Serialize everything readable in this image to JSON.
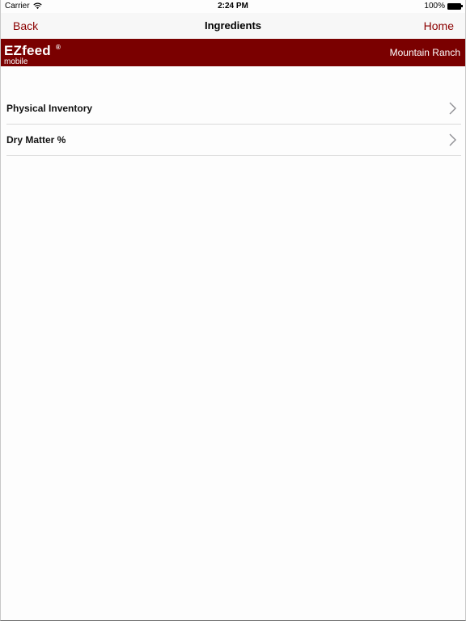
{
  "status_bar": {
    "carrier": "Carrier",
    "time": "2:24 PM",
    "battery": "100%"
  },
  "nav": {
    "back_label": "Back",
    "title": "Ingredients",
    "home_label": "Home"
  },
  "banner": {
    "brand": "EZfeed",
    "registered_mark": "®",
    "subtitle": "mobile",
    "ranch": "Mountain Ranch",
    "color": "#7a0000"
  },
  "accent_color": "#8b0000",
  "menu": {
    "items": [
      {
        "label": "Physical Inventory",
        "icon": "chevron-right-icon"
      },
      {
        "label": "Dry Matter %",
        "icon": "chevron-right-icon"
      }
    ]
  }
}
